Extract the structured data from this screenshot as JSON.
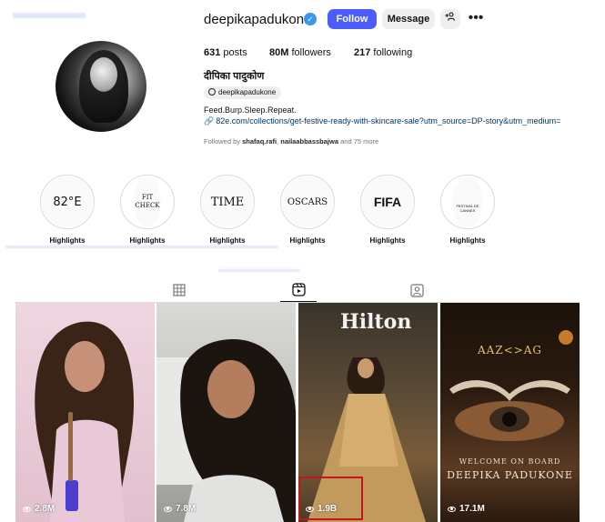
{
  "header": {
    "username": "deepikapadukone",
    "follow_label": "Follow",
    "message_label": "Message",
    "more_label": "•••",
    "stats": {
      "posts": "631",
      "posts_label": "posts",
      "followers": "80M",
      "followers_label": "followers",
      "following": "217",
      "following_label": "following"
    },
    "full_name": "दीपिका पादुकोण",
    "threads_handle": "deepikapadukone",
    "bio": "Feed.Burp.Sleep.Repeat.",
    "link": "82e.com/collections/get-festive-ready-with-skincare-sale?utm_source=DP-story&utm_medium=",
    "followed_by": {
      "prefix": "Followed by",
      "user1": "shafaq.rafi",
      "user2": "nailaabbassbajwa",
      "suffix": "and 75 more"
    }
  },
  "highlights": [
    {
      "cover_text": "82°E",
      "label": "Highlights"
    },
    {
      "cover_text": "FIT CHECK",
      "label": "Highlights"
    },
    {
      "cover_text": "TIME",
      "label": "Highlights"
    },
    {
      "cover_text": "OSCARS",
      "label": "Highlights"
    },
    {
      "cover_text": "FIFA",
      "label": "Highlights"
    },
    {
      "cover_text": "FESTIVAL DE CANNES",
      "label": "Highlights"
    }
  ],
  "tabs": [
    {
      "icon": "grid-icon",
      "active": false
    },
    {
      "icon": "reels-icon",
      "active": true
    },
    {
      "icon": "tagged-icon",
      "active": false
    }
  ],
  "reels": [
    {
      "views": "2.8M"
    },
    {
      "views": "7.8M"
    },
    {
      "views": "1.9B",
      "overlay_text": "Hilton"
    },
    {
      "views": "17.1M",
      "subtitle": "AAZ<>AG",
      "welcome": "WELCOME ON BOARD",
      "name": "DEEPIKA PADUKONE"
    }
  ],
  "colors": {
    "follow_button": "#4a5dfc",
    "verified": "#3897f0",
    "link": "#00376b",
    "highlight_box": "#c0161c"
  }
}
